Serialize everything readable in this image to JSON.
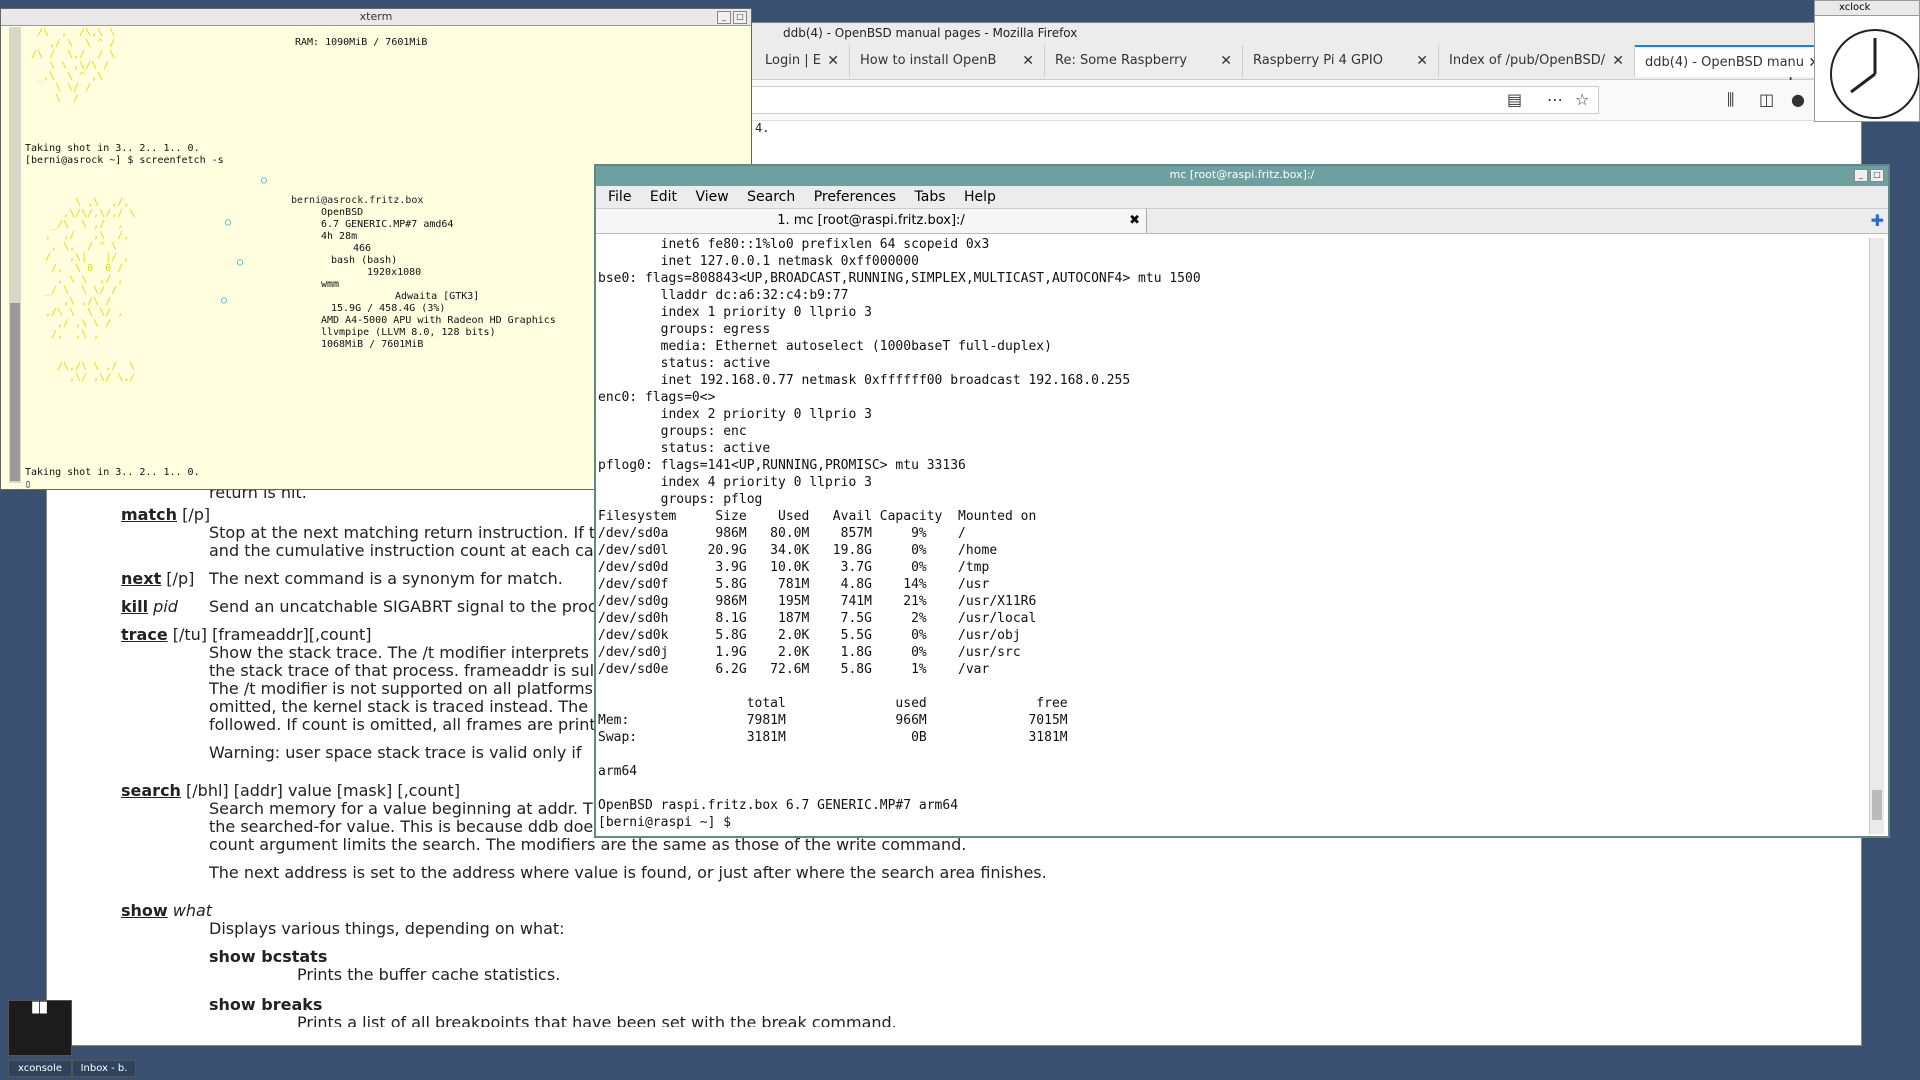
{
  "firefox": {
    "title": "ddb(4) - OpenBSD manual pages - Mozilla Firefox",
    "tabs": [
      {
        "label": "Login | E"
      },
      {
        "label": "How to install OpenB"
      },
      {
        "label": "Re: Some Raspberry"
      },
      {
        "label": "Raspberry Pi 4 GPIO"
      },
      {
        "label": "Index of /pub/OpenBSD/"
      },
      {
        "label": "ddb(4) - OpenBSD manu"
      }
    ],
    "page_top_fragment": "4.",
    "man": {
      "return_frag": "return is hit.",
      "match_cmd": "match",
      "match_args": " [/p]",
      "match_desc1": "Stop at the next matching return instruction. If t",
      "match_desc2": "and the cumulative instruction count at each ca",
      "next_cmd": "next",
      "next_args": " [/p]",
      "next_desc": "The next command is a synonym for match.",
      "kill_cmd": "kill",
      "kill_args": " pid",
      "kill_desc": "Send an uncatchable SIGABRT signal to the proces",
      "trace_cmd": "trace",
      "trace_args": " [/tu] [frameaddr][,count]",
      "trace_d1": "Show the stack trace. The /t modifier interprets",
      "trace_d2": "the stack trace of that process. frameaddr is sul",
      "trace_d3": "The /t modifier is not supported on all platforms",
      "trace_d4": "omitted, the kernel stack is traced instead. The c",
      "trace_d5": "followed. If count is omitted, all frames are print",
      "trace_warn": "Warning: user space stack trace is valid only if",
      "search_cmd": "search",
      "search_args": " [/bhl] [addr] value [mask] [,count]",
      "search_d1": "Search memory for a value beginning at addr. T",
      "search_d2": "the searched-for value. This is because ddb doesn't always recover from touching bad memory. The optional",
      "search_d3": "count argument limits the search. The modifiers are the same as those of the write command.",
      "search_d4": "The next address is set to the address where value is found, or just after where the search area finishes.",
      "show_cmd": "show",
      "show_args": " what",
      "show_desc": "Displays various things, depending on what:",
      "bcstats": "show bcstats",
      "bcstats_desc": "Prints the buffer cache statistics.",
      "breaks": "show breaks",
      "breaks_desc": "Prints a list of all breakpoints that have been set with the break command."
    }
  },
  "xclock": {
    "title": "xclock"
  },
  "xterm": {
    "title": "xterm",
    "lines": {
      "ram_top": "RAM: 1090MiB / 7601MiB",
      "shot1": "Taking shot in 3.. 2.. 1.. 0.",
      "prompt_cmd": "[berni@asrock ~] $ screenfetch -s",
      "host": "berni@asrock.fritz.box",
      "os": "OpenBSD",
      "kernel": "6.7 GENERIC.MP#7 amd64",
      "uptime": "4h 28m",
      "packages": "466",
      "shell": "bash (bash)",
      "resolution": "1920x1080",
      "wm": "wmm",
      "gtk": "Adwaita [GTK3]",
      "disk": "15.9G / 458.4G (3%)",
      "cpu": "AMD A4-5000 APU with Radeon HD Graphics",
      "gpu": "llvmpipe (LLVM 8.0, 128 bits)",
      "ram": "1068MiB / 7601MiB",
      "shot2": "Taking shot in 3.. 2.. 1.. 0."
    }
  },
  "mc": {
    "title": "mc [root@raspi.fritz.box]:/",
    "menu": [
      "File",
      "Edit",
      "View",
      "Search",
      "Preferences",
      "Tabs",
      "Help"
    ],
    "tab_label": "1. mc [root@raspi.fritz.box]:/",
    "terminal": [
      "        inet6 fe80::1%lo0 prefixlen 64 scopeid 0x3",
      "        inet 127.0.0.1 netmask 0xff000000",
      "bse0: flags=808843<UP,BROADCAST,RUNNING,SIMPLEX,MULTICAST,AUTOCONF4> mtu 1500",
      "        lladdr dc:a6:32:c4:b9:77",
      "        index 1 priority 0 llprio 3",
      "        groups: egress",
      "        media: Ethernet autoselect (1000baseT full-duplex)",
      "        status: active",
      "        inet 192.168.0.77 netmask 0xffffff00 broadcast 192.168.0.255",
      "enc0: flags=0<>",
      "        index 2 priority 0 llprio 3",
      "        groups: enc",
      "        status: active",
      "pflog0: flags=141<UP,RUNNING,PROMISC> mtu 33136",
      "        index 4 priority 0 llprio 3",
      "        groups: pflog",
      "Filesystem     Size    Used   Avail Capacity  Mounted on",
      "/dev/sd0a      986M   80.0M    857M     9%    /",
      "/dev/sd0l     20.9G   34.0K   19.8G     0%    /home",
      "/dev/sd0d      3.9G   10.0K    3.7G     0%    /tmp",
      "/dev/sd0f      5.8G    781M    4.8G    14%    /usr",
      "/dev/sd0g      986M    195M    741M    21%    /usr/X11R6",
      "/dev/sd0h      8.1G    187M    7.5G     2%    /usr/local",
      "/dev/sd0k      5.8G    2.0K    5.5G     0%    /usr/obj",
      "/dev/sd0j      1.9G    2.0K    1.8G     0%    /usr/src",
      "/dev/sd0e      6.2G   72.6M    5.8G     1%    /var",
      "",
      "                   total              used              free",
      "Mem:               7981M              966M             7015M",
      "Swap:              3181M                0B             3181M",
      "",
      "arm64",
      "",
      "OpenBSD raspi.fritz.box 6.7 GENERIC.MP#7 arm64",
      "[berni@raspi ~] $ "
    ]
  },
  "taskbar": {
    "items": [
      {
        "label": "xconsole"
      },
      {
        "label": "Inbox - b."
      }
    ]
  }
}
